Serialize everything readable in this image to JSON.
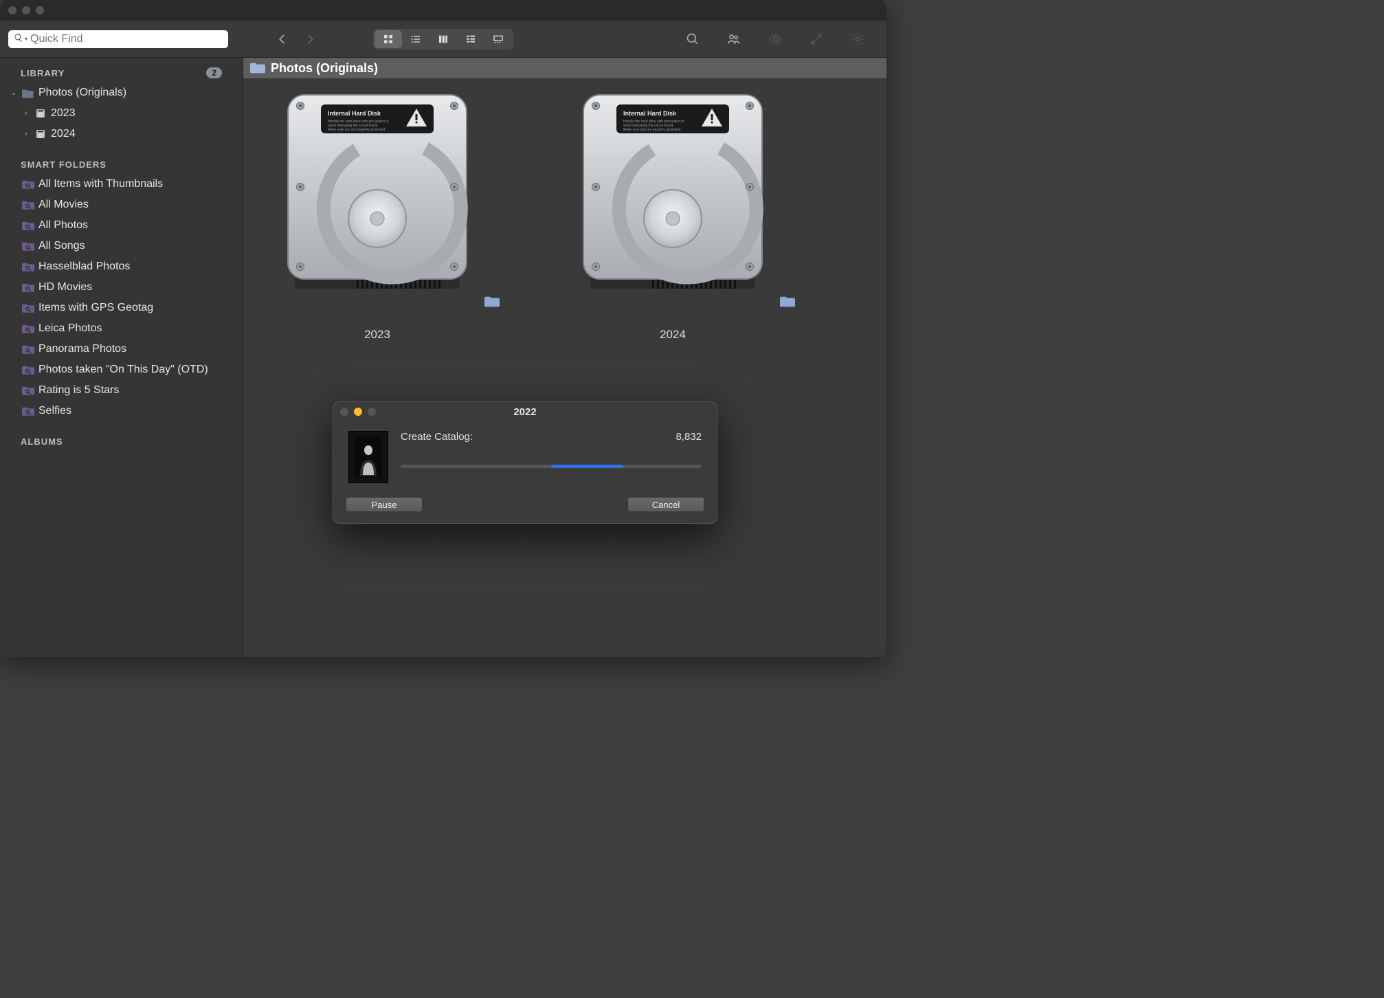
{
  "search": {
    "placeholder": "Quick Find"
  },
  "sidebar": {
    "library_header": "LIBRARY",
    "library_badge": "2",
    "root_folder": "Photos (Originals)",
    "root_children": [
      "2023",
      "2024"
    ],
    "smart_header": "SMART FOLDERS",
    "smart": [
      "All Items with Thumbnails",
      "All Movies",
      "All Photos",
      "All Songs",
      "Hasselblad Photos",
      "HD Movies",
      "Items with GPS Geotag",
      "Leica Photos",
      "Panorama Photos",
      "Photos taken \"On This Day\" (OTD)",
      "Rating is 5 Stars",
      "Selfies"
    ],
    "albums_header": "ALBUMS"
  },
  "pathbar": {
    "title": "Photos (Originals)"
  },
  "grid": {
    "items": [
      {
        "label": "2023",
        "drive_label": "Internal Hard Disk"
      },
      {
        "label": "2024",
        "drive_label": "Internal Hard Disk"
      }
    ]
  },
  "dialog": {
    "title": "2022",
    "task_label": "Create Catalog:",
    "count": "8,832",
    "progress_start_pct": 50,
    "progress_width_pct": 24,
    "pause_label": "Pause",
    "cancel_label": "Cancel"
  }
}
